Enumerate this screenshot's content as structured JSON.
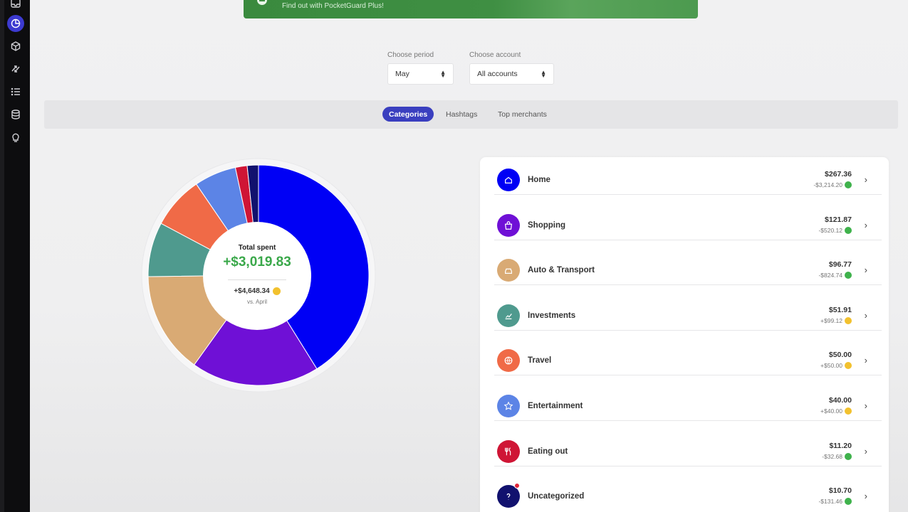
{
  "banner": {
    "text": "Find out with PocketGuard Plus!"
  },
  "filters": {
    "period_label": "Choose period",
    "period_value": "May",
    "account_label": "Choose account",
    "account_value": "All accounts"
  },
  "tabs": [
    {
      "label": "Categories",
      "active": true
    },
    {
      "label": "Hashtags",
      "active": false
    },
    {
      "label": "Top merchants",
      "active": false
    }
  ],
  "summary": {
    "title": "Total spent",
    "amount": "+$3,019.83",
    "diff": "+$4,648.34",
    "vs": "vs. April"
  },
  "chart_data": {
    "type": "pie",
    "donut": true,
    "categories": [
      "Home",
      "Shopping",
      "Auto & Transport",
      "Investments",
      "Travel",
      "Entertainment",
      "Eating out",
      "Uncategorized"
    ],
    "values": [
      267.36,
      121.87,
      96.77,
      51.91,
      50.0,
      40.0,
      11.2,
      10.7
    ],
    "colors": [
      "#0000f5",
      "#6f10d6",
      "#d9aa74",
      "#4f9a8e",
      "#f06a47",
      "#5c84e6",
      "#cf1535",
      "#11116e"
    ]
  },
  "categories": [
    {
      "name": "Home",
      "amount": "$267.36",
      "change": "-$3,214.20",
      "coin": "green",
      "color": "#0000f5",
      "icon": "home-icon"
    },
    {
      "name": "Shopping",
      "amount": "$121.87",
      "change": "-$520.12",
      "coin": "green",
      "color": "#6f10d6",
      "icon": "shopping-bag-icon"
    },
    {
      "name": "Auto & Transport",
      "amount": "$96.77",
      "change": "-$824.74",
      "coin": "green",
      "color": "#d9aa74",
      "icon": "car-icon"
    },
    {
      "name": "Investments",
      "amount": "$51.91",
      "change": "+$99.12",
      "coin": "yellow",
      "color": "#4f9a8e",
      "icon": "investment-chart-icon"
    },
    {
      "name": "Travel",
      "amount": "$50.00",
      "change": "+$50.00",
      "coin": "yellow",
      "color": "#f06a47",
      "icon": "globe-icon"
    },
    {
      "name": "Entertainment",
      "amount": "$40.00",
      "change": "+$40.00",
      "coin": "yellow",
      "color": "#5c84e6",
      "icon": "star-icon"
    },
    {
      "name": "Eating out",
      "amount": "$11.20",
      "change": "-$32.68",
      "coin": "green",
      "color": "#cf1535",
      "icon": "utensils-icon"
    },
    {
      "name": "Uncategorized",
      "amount": "$10.70",
      "change": "-$131.46",
      "coin": "green",
      "color": "#11116e",
      "icon": "question-icon"
    }
  ],
  "sidebar": {
    "items": [
      {
        "icon": "inbox-icon"
      },
      {
        "icon": "pie-chart-icon",
        "active": true
      },
      {
        "icon": "cube-icon"
      },
      {
        "icon": "refresh-arrows-icon"
      },
      {
        "icon": "list-icon"
      },
      {
        "icon": "database-icon"
      },
      {
        "icon": "lightbulb-icon"
      }
    ]
  }
}
